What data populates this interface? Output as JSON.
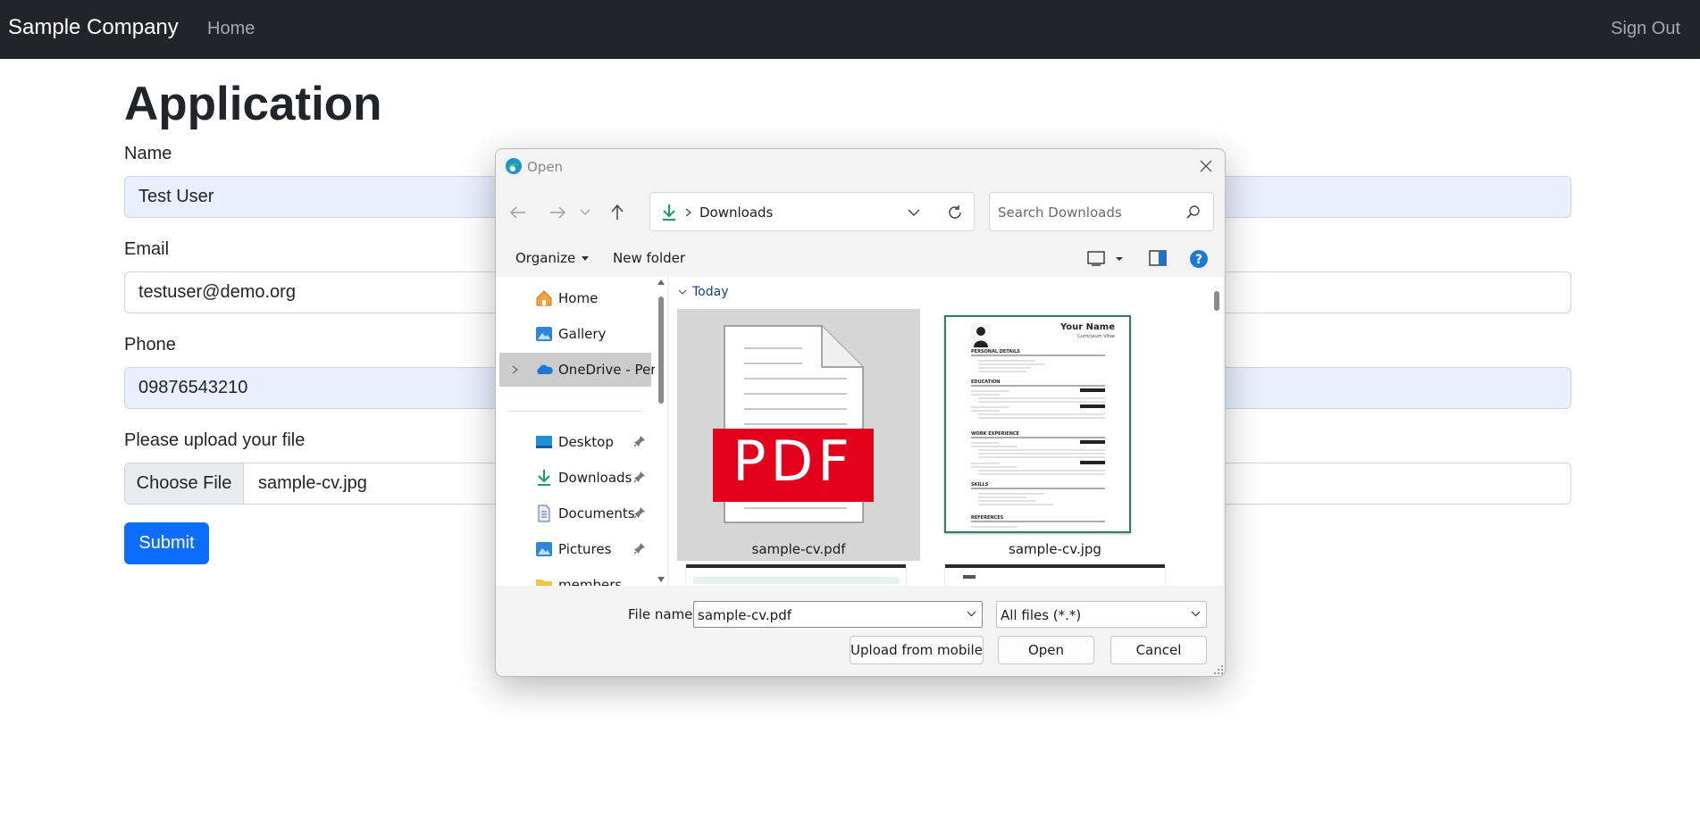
{
  "navbar": {
    "brand": "Sample Company",
    "home": "Home",
    "sign_out": "Sign Out"
  },
  "form": {
    "title": "Application",
    "name_label": "Name",
    "name_value": "Test User",
    "email_label": "Email",
    "email_value": "testuser@demo.org",
    "phone_label": "Phone",
    "phone_value": "09876543210",
    "file_label": "Please upload your file",
    "choose_file": "Choose File",
    "chosen_file": "sample-cv.jpg",
    "submit": "Submit"
  },
  "dialog": {
    "title": "Open",
    "address": "Downloads",
    "search_placeholder": "Search Downloads",
    "organize": "Organize",
    "new_folder": "New folder",
    "nav_items": [
      {
        "label": "Home",
        "icon": "home-icon"
      },
      {
        "label": "Gallery",
        "icon": "gallery-icon"
      },
      {
        "label": "OneDrive - Perso",
        "icon": "onedrive-icon"
      },
      {
        "label": "Desktop",
        "icon": "desktop-icon"
      },
      {
        "label": "Downloads",
        "icon": "downloads-icon"
      },
      {
        "label": "Documents",
        "icon": "documents-icon"
      },
      {
        "label": "Pictures",
        "icon": "pictures-icon"
      },
      {
        "label": "members",
        "icon": "folder-icon"
      }
    ],
    "group_header": "Today",
    "files": [
      {
        "name": "sample-cv.pdf",
        "icon": "pdf-file-icon",
        "selected": true
      },
      {
        "name": "sample-cv.jpg",
        "icon": "image-file-icon",
        "selected": false
      }
    ],
    "pdf_badge": "PDF",
    "resume_preview": {
      "name": "Your Name",
      "subtitle": "Curriculum Vitae",
      "sections": [
        "PERSONAL DETAILS",
        "EDUCATION",
        "WORK EXPERIENCE",
        "SKILLS",
        "REFERENCES"
      ]
    },
    "file_name_label": "File name:",
    "file_name_value": "sample-cv.pdf",
    "file_type": "All files (*.*)",
    "upload_mobile": "Upload from mobile",
    "open": "Open",
    "cancel": "Cancel"
  }
}
